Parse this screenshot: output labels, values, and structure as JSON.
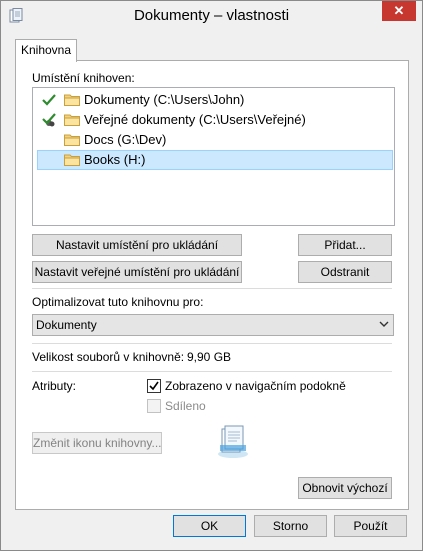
{
  "window": {
    "title": "Dokumenty – vlastnosti",
    "close_glyph": "✕"
  },
  "tabs": [
    {
      "label": "Knihovna"
    }
  ],
  "locations": {
    "label": "Umístění knihoven:",
    "items": [
      {
        "text": "Dokumenty (C:\\Users\\John)",
        "status": "save-location-check"
      },
      {
        "text": "Veřejné dokumenty (C:\\Users\\Veřejné)",
        "status": "public-save-location-check"
      },
      {
        "text": "Docs (G:\\Dev)",
        "status": ""
      },
      {
        "text": "Books (H:)",
        "status": "",
        "selected": true
      }
    ]
  },
  "buttons": {
    "set_save": "Nastavit umístění pro ukládání",
    "add": "Přidat...",
    "set_public_save": "Nastavit veřejné umístění pro ukládání",
    "remove": "Odstranit",
    "change_icon": "Změnit ikonu knihovny...",
    "restore_defaults": "Obnovit výchozí"
  },
  "optimize": {
    "label": "Optimalizovat tuto knihovnu pro:",
    "value": "Dokumenty"
  },
  "size": {
    "label": "Velikost souborů v knihovně:",
    "value": "9,90 GB"
  },
  "attributes": {
    "label": "Atributy:",
    "show_in_nav": {
      "label": "Zobrazeno v navigačním podokně",
      "checked": true
    },
    "shared": {
      "label": "Sdíleno",
      "checked": false,
      "disabled": true
    }
  },
  "footer": {
    "ok": "OK",
    "cancel": "Storno",
    "apply": "Použít"
  },
  "colors": {
    "close": "#c7372f",
    "selection": "#cce8ff",
    "check": "#2e8b2e"
  }
}
